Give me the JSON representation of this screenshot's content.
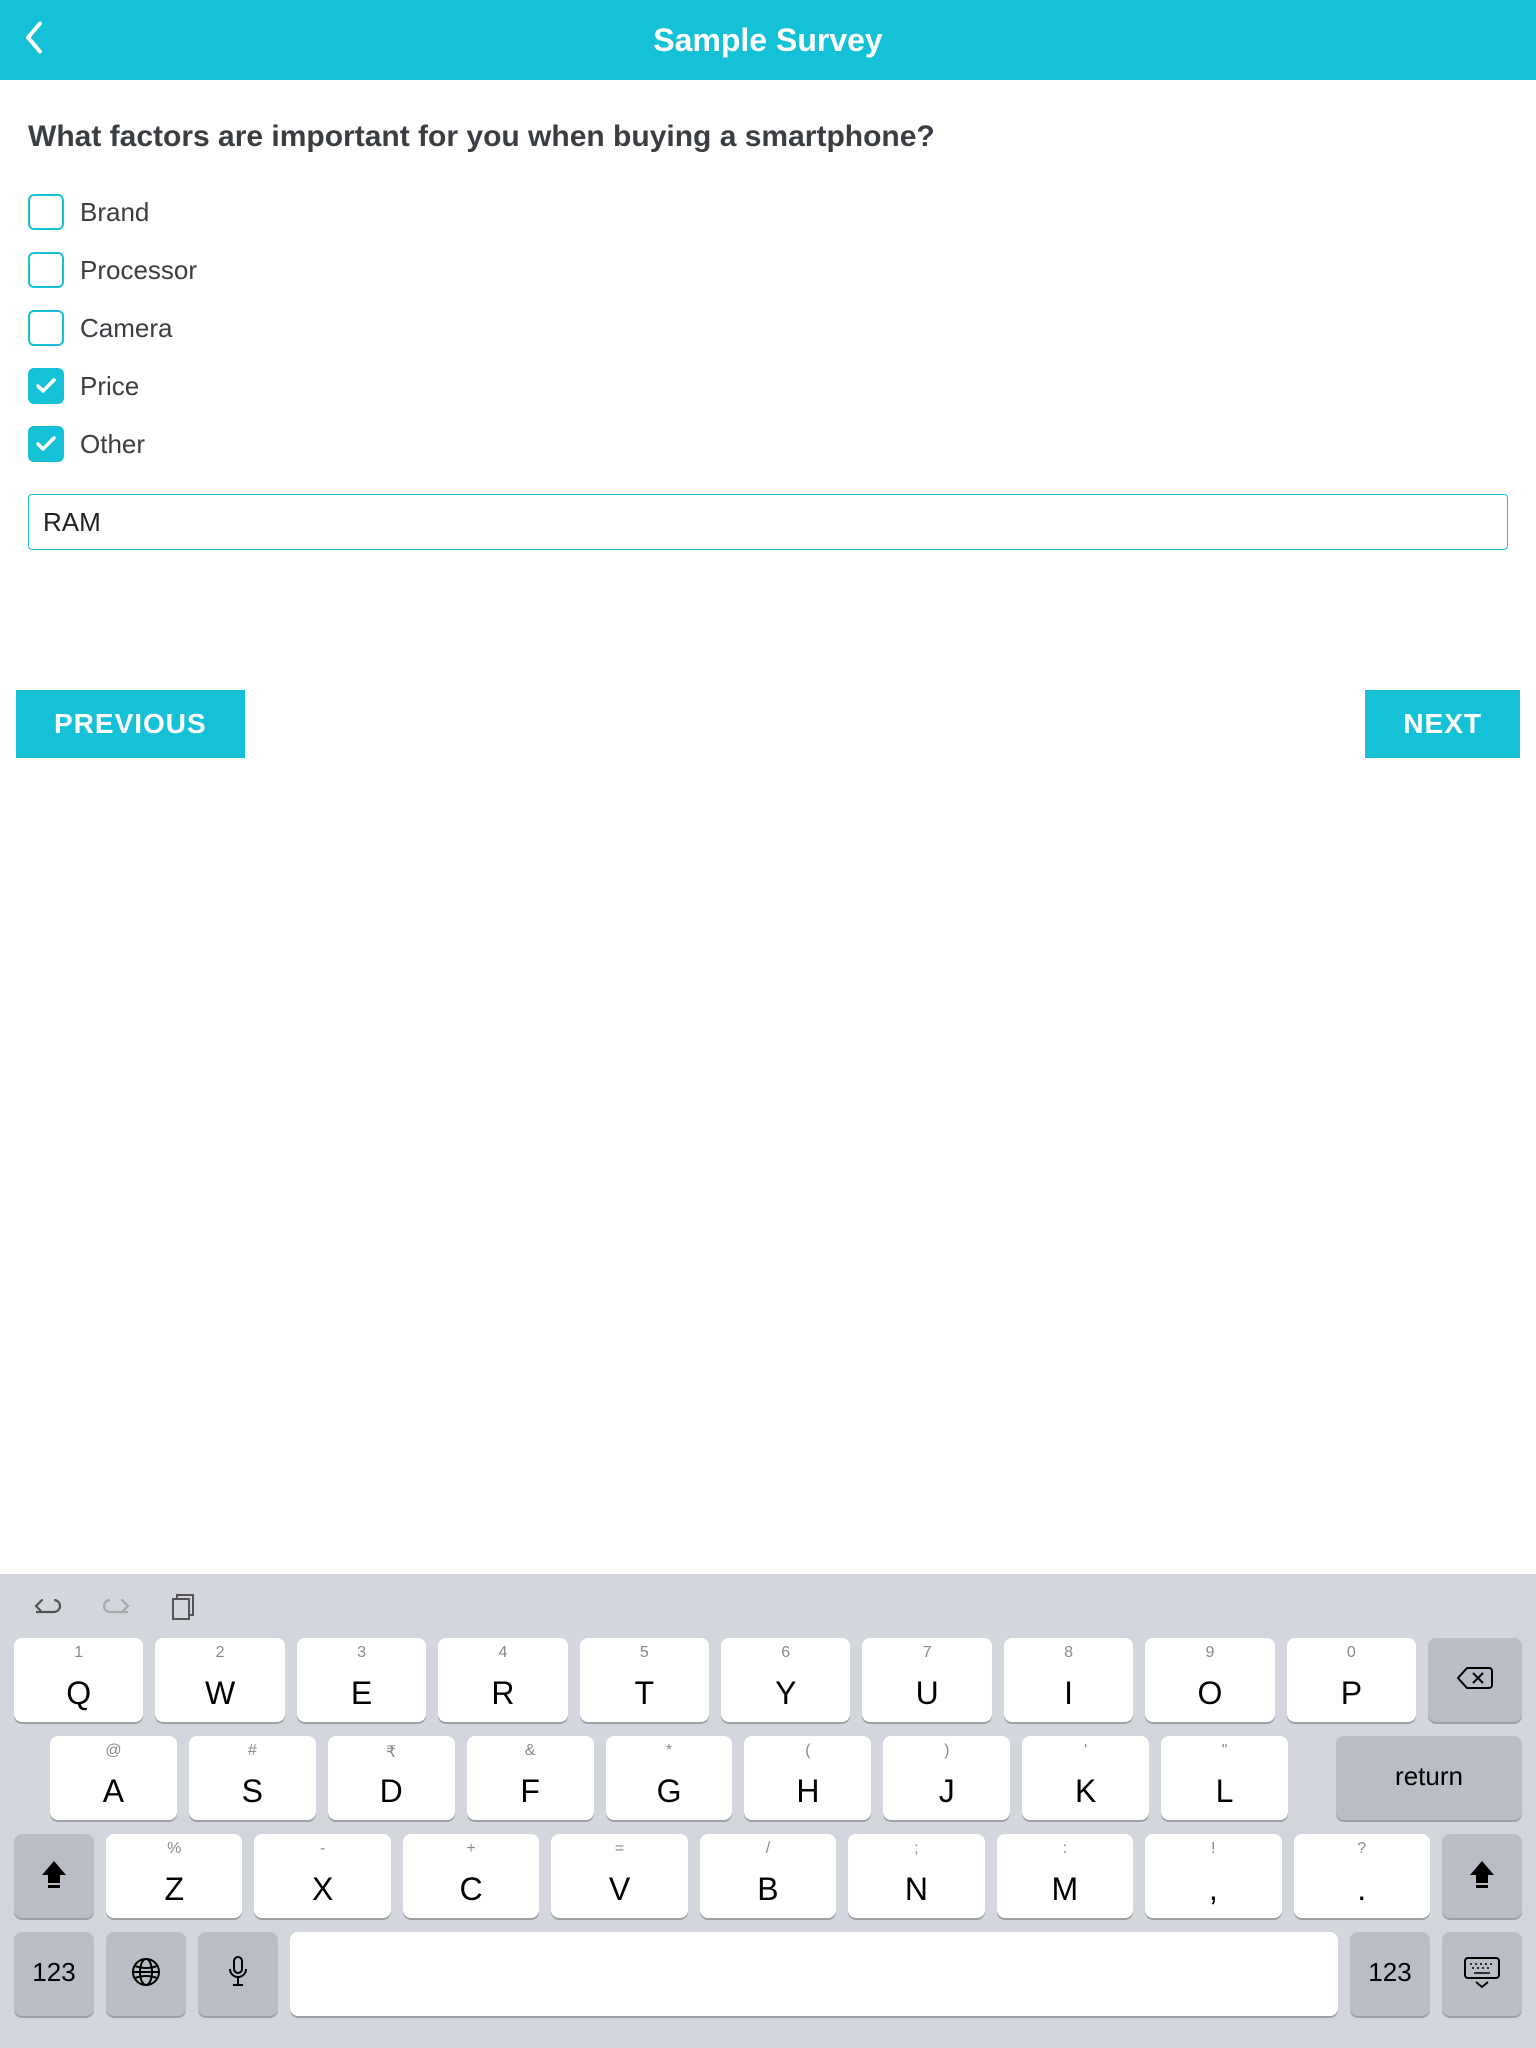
{
  "header": {
    "title": "Sample Survey"
  },
  "question": "What factors are important for you when buying a smartphone?",
  "options": [
    {
      "label": "Brand",
      "checked": false
    },
    {
      "label": "Processor",
      "checked": false
    },
    {
      "label": "Camera",
      "checked": false
    },
    {
      "label": "Price",
      "checked": true
    },
    {
      "label": "Other",
      "checked": true
    }
  ],
  "other_value": "RAM",
  "nav": {
    "previous": "PREVIOUS",
    "next": "NEXT"
  },
  "keyboard": {
    "row1": [
      {
        "hint": "1",
        "main": "Q"
      },
      {
        "hint": "2",
        "main": "W"
      },
      {
        "hint": "3",
        "main": "E"
      },
      {
        "hint": "4",
        "main": "R"
      },
      {
        "hint": "5",
        "main": "T"
      },
      {
        "hint": "6",
        "main": "Y"
      },
      {
        "hint": "7",
        "main": "U"
      },
      {
        "hint": "8",
        "main": "I"
      },
      {
        "hint": "9",
        "main": "O"
      },
      {
        "hint": "0",
        "main": "P"
      }
    ],
    "row2": [
      {
        "hint": "@",
        "main": "A"
      },
      {
        "hint": "#",
        "main": "S"
      },
      {
        "hint": "₹",
        "main": "D"
      },
      {
        "hint": "&",
        "main": "F"
      },
      {
        "hint": "*",
        "main": "G"
      },
      {
        "hint": "(",
        "main": "H"
      },
      {
        "hint": ")",
        "main": "J"
      },
      {
        "hint": "'",
        "main": "K"
      },
      {
        "hint": "\"",
        "main": "L"
      }
    ],
    "row3": [
      {
        "hint": "%",
        "main": "Z"
      },
      {
        "hint": "-",
        "main": "X"
      },
      {
        "hint": "+",
        "main": "C"
      },
      {
        "hint": "=",
        "main": "V"
      },
      {
        "hint": "/",
        "main": "B"
      },
      {
        "hint": ";",
        "main": "N"
      },
      {
        "hint": ":",
        "main": "M"
      },
      {
        "hint": "!",
        "main": ","
      },
      {
        "hint": "?",
        "main": "."
      }
    ],
    "return_label": "return",
    "num_label": "123"
  }
}
